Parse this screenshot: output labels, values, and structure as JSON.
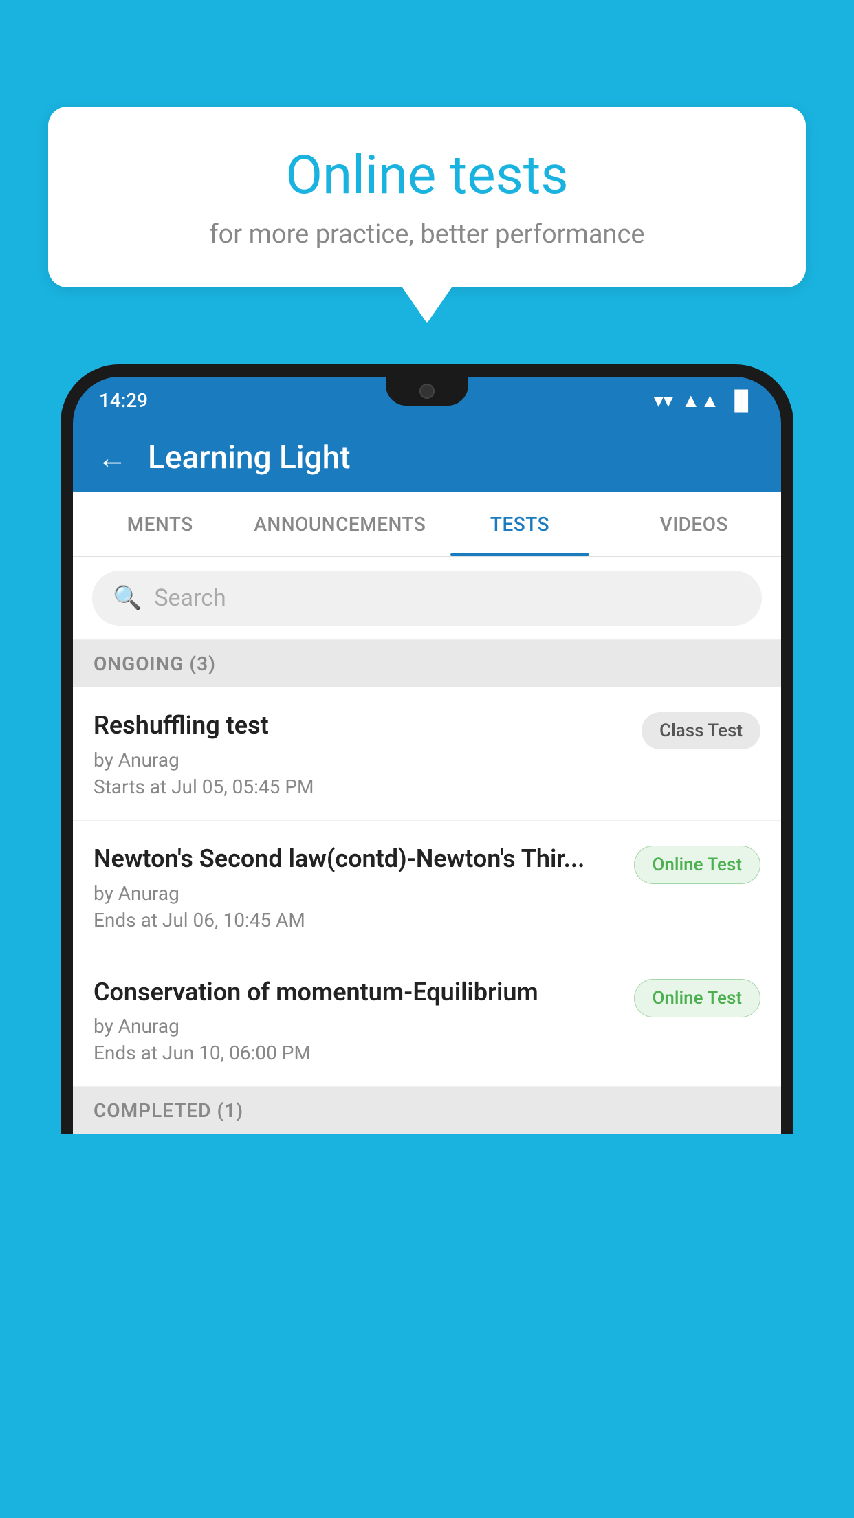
{
  "background": {
    "color": "#1ab3e0"
  },
  "speech_bubble": {
    "title": "Online tests",
    "subtitle": "for more practice, better performance"
  },
  "phone": {
    "status_bar": {
      "time": "14:29",
      "wifi": "▼",
      "signal": "▲",
      "battery": "▌"
    },
    "header": {
      "back_label": "←",
      "title": "Learning Light"
    },
    "tabs": [
      {
        "label": "MENTS",
        "active": false
      },
      {
        "label": "ANNOUNCEMENTS",
        "active": false
      },
      {
        "label": "TESTS",
        "active": true
      },
      {
        "label": "VIDEOS",
        "active": false
      }
    ],
    "search": {
      "placeholder": "Search"
    },
    "sections": [
      {
        "header": "ONGOING (3)",
        "items": [
          {
            "name": "Reshuffling test",
            "by": "by Anurag",
            "time": "Starts at  Jul 05, 05:45 PM",
            "badge": "Class Test",
            "badge_type": "class"
          },
          {
            "name": "Newton's Second law(contd)-Newton's Thir...",
            "by": "by Anurag",
            "time": "Ends at  Jul 06, 10:45 AM",
            "badge": "Online Test",
            "badge_type": "online"
          },
          {
            "name": "Conservation of momentum-Equilibrium",
            "by": "by Anurag",
            "time": "Ends at  Jun 10, 06:00 PM",
            "badge": "Online Test",
            "badge_type": "online"
          }
        ]
      },
      {
        "header": "COMPLETED (1)",
        "items": []
      }
    ]
  }
}
